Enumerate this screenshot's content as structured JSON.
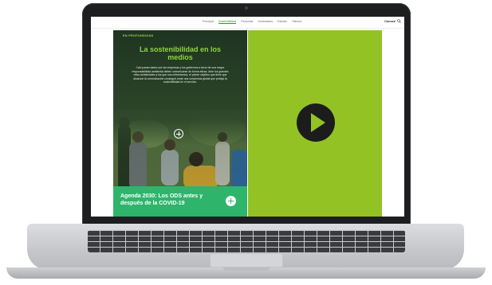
{
  "nav": {
    "items": [
      "Principal",
      "Sostenibilidad",
      "Personas",
      "Sociedades",
      "Estudio",
      "Historia"
    ],
    "active_index": 1,
    "cta": "Conocé"
  },
  "left_panel": {
    "eyebrow": "EN PROFUNDIDAD",
    "headline": "La sostenibilidad en los medios",
    "body": "Casi pasan dados por las empresas y los gobiernos a favor de una mayor responsabilidad ambiental deben comunicarse de forma eficaz. Ante los grandes retos ambientales a los que nos enfrentamos, el primer objetivo que tiene que alcanzar la comunicación conseguir crear una conciencia global que proteja la sostenibilidad en el servicio."
  },
  "agenda": {
    "title": "Agenda 2030: Los ODS antes y después de la COVID-19"
  },
  "video": {
    "accent": "#93c225"
  },
  "colors": {
    "headline": "#8ed63f",
    "agenda_bg": "#2fb46c",
    "nav_active": "#3a8f3c"
  }
}
